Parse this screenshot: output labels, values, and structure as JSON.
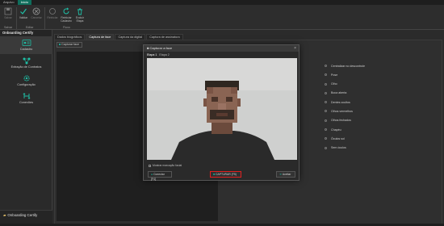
{
  "menubar": {
    "tabs": [
      {
        "label": "Arquivo"
      },
      {
        "label": "Início"
      }
    ]
  },
  "ribbon": {
    "buttons": [
      {
        "label": "Salvar",
        "icon": "save-icon"
      },
      {
        "label": "Validar",
        "icon": "check-icon"
      },
      {
        "label": "Cancelar",
        "icon": "cancel-icon"
      },
      {
        "label": "Reiniciar",
        "icon": "reset-icon"
      },
      {
        "label": "Reiniciar Cadastro",
        "icon": "refresh-icon"
      },
      {
        "label": "Excluir Etapa",
        "icon": "delete-icon"
      }
    ],
    "groups": {
      "save": "Salvar",
      "edit": "Editar",
      "flow": "Fluxo"
    }
  },
  "sidebar": {
    "title": "Onboarding Certify",
    "items": [
      {
        "label": "Cadastro",
        "icon": "id-card-icon"
      },
      {
        "label": "Extração de Contratos",
        "icon": "network-icon"
      },
      {
        "label": "Configuração",
        "icon": "settings-icon"
      },
      {
        "label": "Conexões",
        "icon": "connections-icon"
      }
    ],
    "footer": "Onboarding Certify"
  },
  "tabs": [
    {
      "label": "Dados biográficos"
    },
    {
      "label": "Captura de face"
    },
    {
      "label": "Captura da digital"
    },
    {
      "label": "Captura de assinatura"
    }
  ],
  "content": {
    "capture_button": "Capturar face"
  },
  "status_items": [
    "Centralizar no descontrole",
    "Pose",
    "Olho",
    "Boca aberta",
    "Dentes ocultos",
    "Olhos vermelhos",
    "Olhos fechados",
    "Chapéu",
    "Óculos sol",
    "Sem óculos"
  ],
  "modal": {
    "title": "Capturar a face",
    "close": "×",
    "tabs": [
      {
        "label": "Etapa 1"
      },
      {
        "label": "Etapa 2"
      }
    ],
    "checkbox_label": "Mostrar marcação facial",
    "buttons": {
      "left": "Conectar [F4]",
      "capture": "CAPTURAR (F5)",
      "right": "Aceitar"
    }
  }
}
